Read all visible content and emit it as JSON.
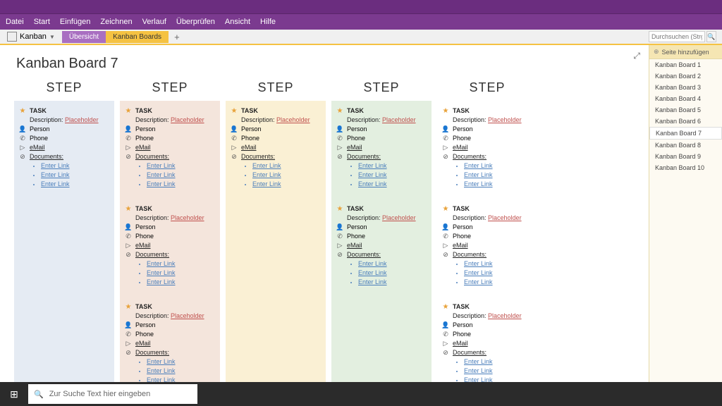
{
  "menu": [
    "Datei",
    "Start",
    "Einfügen",
    "Zeichnen",
    "Verlauf",
    "Überprüfen",
    "Ansicht",
    "Hilfe"
  ],
  "notebook": "Kanban",
  "sections": [
    {
      "label": "Übersicht",
      "active": false
    },
    {
      "label": "Kanban Boards",
      "active": true
    }
  ],
  "search_placeholder": "Durchsuchen (Strg+E)",
  "page_title": "Kanban Board 7",
  "columns": [
    {
      "heading": "STEP",
      "color": "c0",
      "cards": 1
    },
    {
      "heading": "STEP",
      "color": "c1",
      "cards": 3
    },
    {
      "heading": "STEP",
      "color": "c2",
      "cards": 1
    },
    {
      "heading": "STEP",
      "color": "c3",
      "cards": 2
    },
    {
      "heading": "STEP",
      "color": "c4",
      "cards": 3
    }
  ],
  "card_template": {
    "task": "TASK",
    "desc_label": "Description:",
    "desc_value": "Placeholder",
    "person": "Person",
    "phone": "Phone",
    "email": "eMail",
    "documents": "Documents:",
    "link": "Enter Link"
  },
  "sidebar": {
    "add": "Seite hinzufügen",
    "pages": [
      "Kanban Board 1",
      "Kanban Board 2",
      "Kanban Board 3",
      "Kanban Board 4",
      "Kanban Board 5",
      "Kanban Board 6",
      "Kanban Board 7",
      "Kanban Board 8",
      "Kanban Board 9",
      "Kanban Board 10"
    ],
    "selected": 6
  },
  "taskbar_search": "Zur Suche Text hier eingeben"
}
